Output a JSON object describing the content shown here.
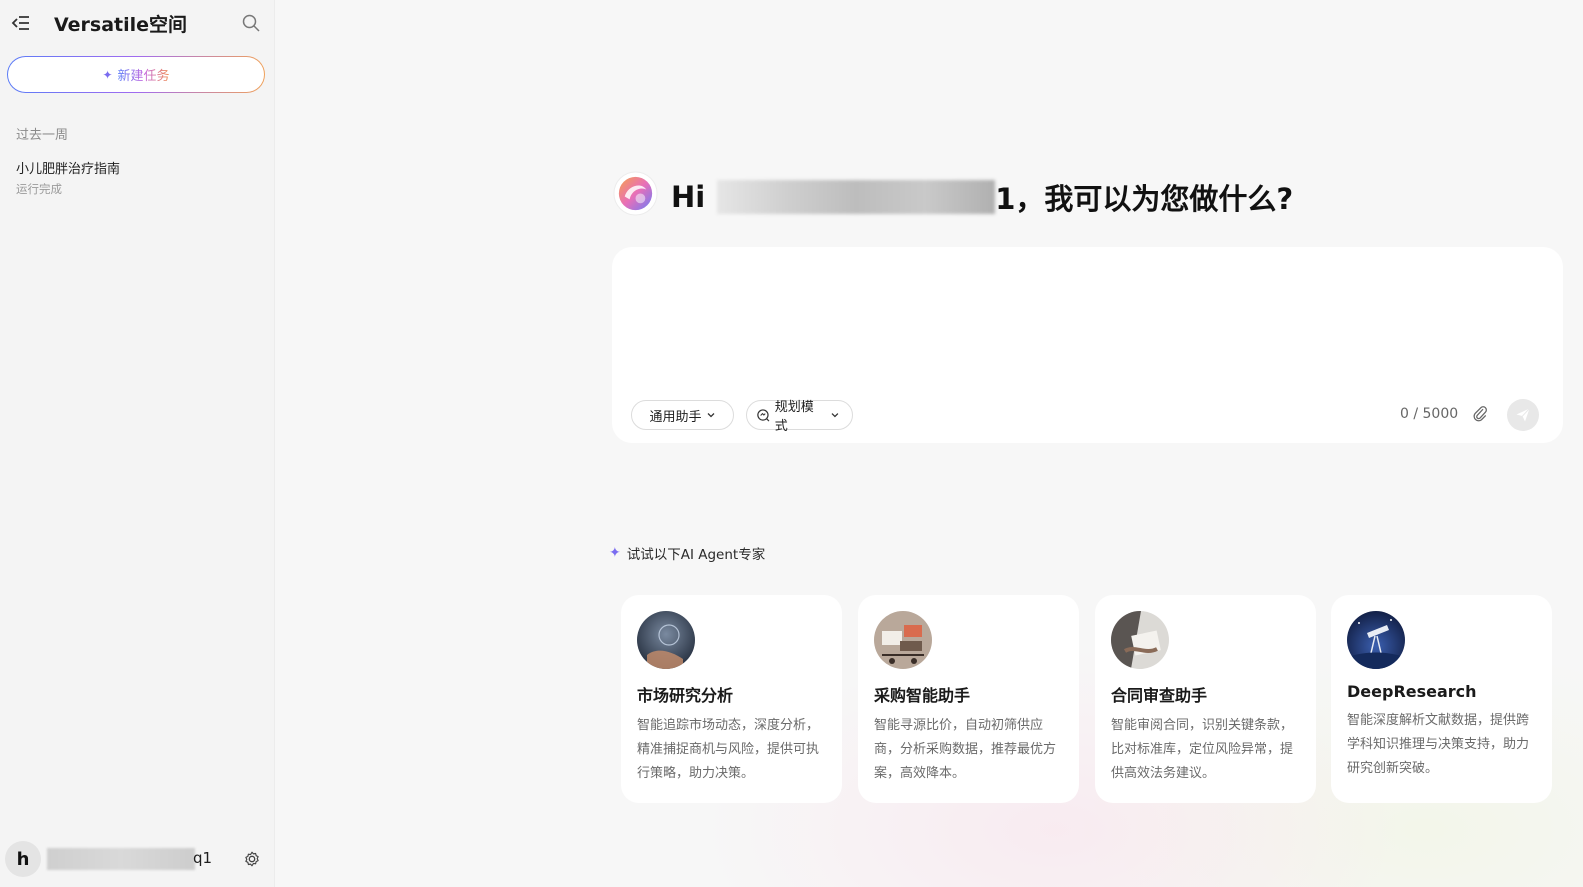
{
  "sidebar": {
    "app_title": "Versatile空间",
    "new_task_label": "新建任务",
    "section_label": "过去一周",
    "history": [
      {
        "title": "小儿肥胖治疗指南",
        "status": "运行完成"
      }
    ],
    "user": {
      "avatar_letter": "h",
      "name_suffix": "q1"
    }
  },
  "main": {
    "greeting_prefix": "Hi",
    "greeting_suffix": "1，我可以为您做什么?",
    "composer": {
      "placeholder": "",
      "assistant_label": "通用助手",
      "mode_label": "规划模式",
      "counter": "0 / 5000"
    },
    "agents_heading": "试试以下AI Agent专家",
    "agents": [
      {
        "title": "市场研究分析",
        "desc": "智能追踪市场动态，深度分析，精准捕捉商机与风险，提供可执行策略，助力决策。"
      },
      {
        "title": "采购智能助手",
        "desc": "智能寻源比价，自动初筛供应商，分析采购数据，推荐最优方案，高效降本。"
      },
      {
        "title": "合同审查助手",
        "desc": "智能审阅合同，识别关键条款，比对标准库，定位风险异常，提供高效法务建议。"
      },
      {
        "title": "DeepResearch",
        "desc": "智能深度解析文献数据，提供跨学科知识推理与决策支持，助力研究创新突破。"
      }
    ]
  },
  "colors": {
    "accent_blue": "#5b7cf7",
    "accent_purple": "#7a6cf0",
    "accent_orange": "#f08a4b"
  },
  "icons": [
    "collapse-icon",
    "search-icon",
    "sparkle-icon",
    "settings-icon",
    "chevron-down-icon",
    "mode-icon",
    "attach-icon",
    "send-icon"
  ]
}
